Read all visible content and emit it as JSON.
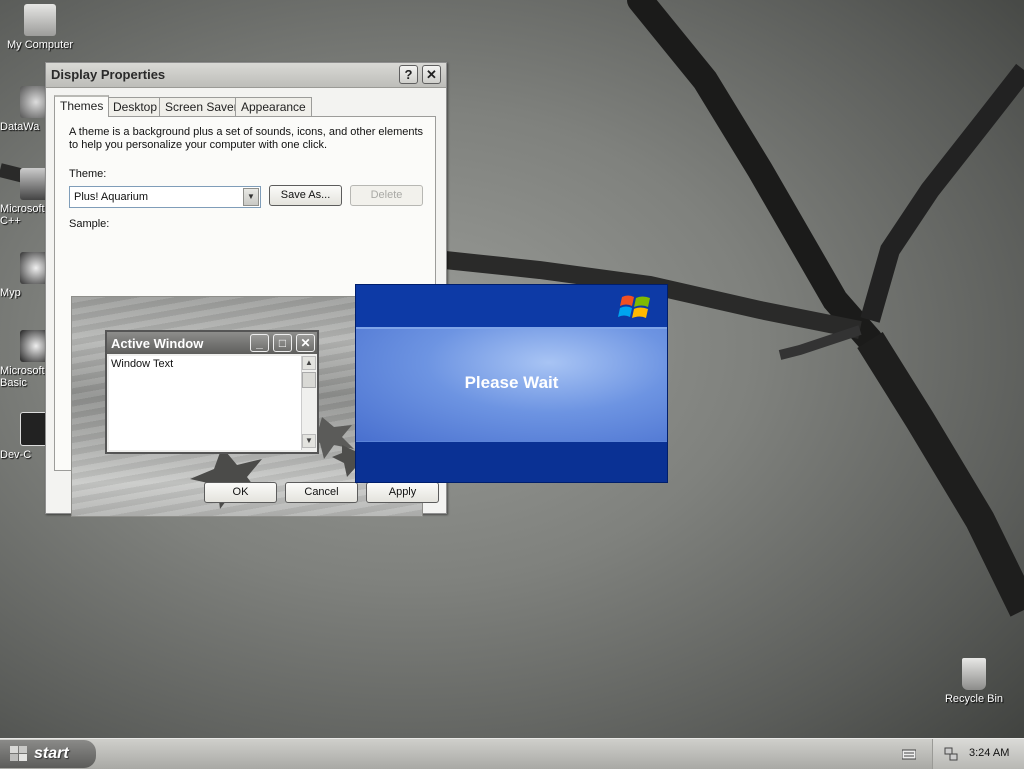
{
  "desktop": {
    "icons": [
      {
        "label": "My Computer"
      },
      {
        "label": "DataWa"
      },
      {
        "label": "Microsoft C++"
      },
      {
        "label": "Myp"
      },
      {
        "label": "Microsoft Basic"
      },
      {
        "label": "Dev-C"
      },
      {
        "label": "Recycle Bin"
      }
    ]
  },
  "display_properties": {
    "title": "Display Properties",
    "help_glyph": "?",
    "close_glyph": "✕",
    "tabs": [
      {
        "label": "Themes",
        "active": true
      },
      {
        "label": "Desktop",
        "active": false
      },
      {
        "label": "Screen Saver",
        "active": false
      },
      {
        "label": "Appearance",
        "active": false
      }
    ],
    "description": "A theme is a background plus a set of sounds, icons, and other elements to help you personalize your computer with one click.",
    "theme_label": "Theme:",
    "theme_value": "Plus! Aquarium",
    "save_as_label": "Save As...",
    "delete_label": "Delete",
    "sample_label": "Sample:",
    "sample": {
      "active_window_title": "Active Window",
      "window_text": "Window Text"
    },
    "ok_label": "OK",
    "cancel_label": "Cancel",
    "apply_label": "Apply"
  },
  "please_wait": {
    "text": "Please Wait",
    "colors": {
      "dark_blue": "#0a3194",
      "light_blue": "#a8c4f4"
    }
  },
  "taskbar": {
    "start_label": "start",
    "clock": "3:24 AM"
  }
}
